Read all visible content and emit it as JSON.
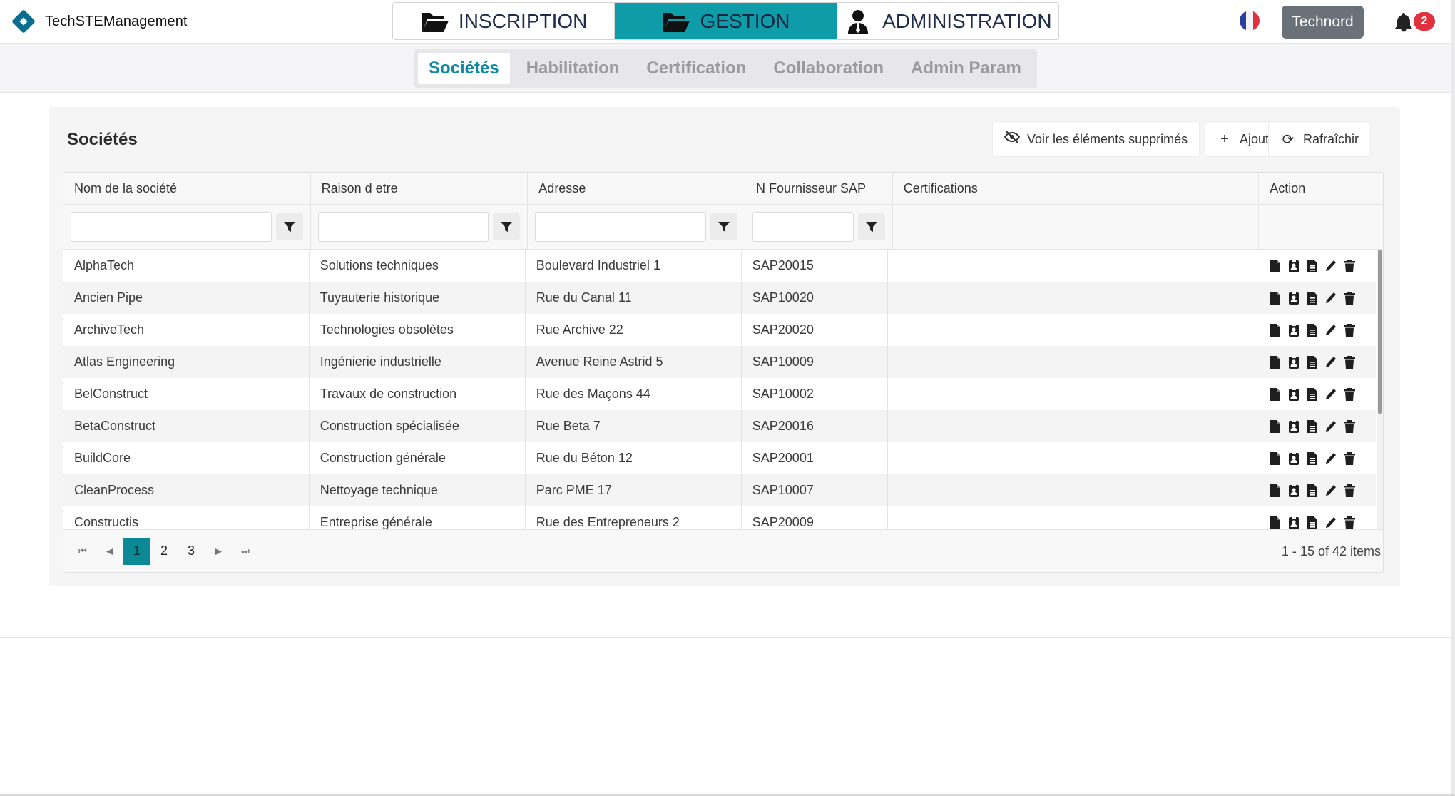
{
  "app": {
    "name": "TechSTEManagement"
  },
  "modules": [
    {
      "label": "INSCRIPTION",
      "icon": "folder-open-icon",
      "active": false
    },
    {
      "label": "GESTION",
      "icon": "folder-open-icon",
      "active": true
    },
    {
      "label": "ADMINISTRATION",
      "icon": "user-tie-icon",
      "active": false
    }
  ],
  "header": {
    "language_flag": "flag-fr-icon",
    "user_label": "Technord",
    "notification_count": "2"
  },
  "subtabs": [
    {
      "label": "Sociétés",
      "active": true
    },
    {
      "label": "Habilitation",
      "active": false
    },
    {
      "label": "Certification",
      "active": false
    },
    {
      "label": "Collaboration",
      "active": false
    },
    {
      "label": "Admin Param",
      "active": false
    }
  ],
  "panel": {
    "title": "Sociétés",
    "buttons": {
      "deleted": "Voir les éléments supprimés",
      "add": "Ajouter",
      "refresh": "Rafraîchir"
    }
  },
  "table": {
    "columns": [
      "Nom de la société",
      "Raison d etre",
      "Adresse",
      "N Fournisseur SAP",
      "Certifications",
      "Action"
    ],
    "rows": [
      [
        "AlphaTech",
        "Solutions techniques",
        "Boulevard Industriel 1",
        "SAP20015",
        ""
      ],
      [
        "Ancien Pipe",
        "Tuyauterie historique",
        "Rue du Canal 11",
        "SAP10020",
        ""
      ],
      [
        "ArchiveTech",
        "Technologies obsolètes",
        "Rue Archive 22",
        "SAP20020",
        ""
      ],
      [
        "Atlas Engineering",
        "Ingénierie industrielle",
        "Avenue Reine Astrid 5",
        "SAP10009",
        ""
      ],
      [
        "BelConstruct",
        "Travaux de construction",
        "Rue des Maçons 44",
        "SAP10002",
        ""
      ],
      [
        "BetaConstruct",
        "Construction spécialisée",
        "Rue Beta 7",
        "SAP20016",
        ""
      ],
      [
        "BuildCore",
        "Construction générale",
        "Rue du Béton 12",
        "SAP20001",
        ""
      ],
      [
        "CleanProcess",
        "Nettoyage technique",
        "Parc PME 17",
        "SAP10007",
        ""
      ],
      [
        "Constructis",
        "Entreprise générale",
        "Rue des Entrepreneurs 2",
        "SAP20009",
        ""
      ]
    ],
    "action_icons": [
      "file-icon",
      "id-badge-icon",
      "file-lines-icon",
      "pencil-icon",
      "trash-icon"
    ]
  },
  "pager": {
    "pages": [
      "1",
      "2",
      "3"
    ],
    "current": "1",
    "info": "1 - 15 of 42 items"
  },
  "colors": {
    "accent": "#0d9ca8",
    "active_tab_text": "#0d8aa6",
    "badge": "#e0313f"
  }
}
